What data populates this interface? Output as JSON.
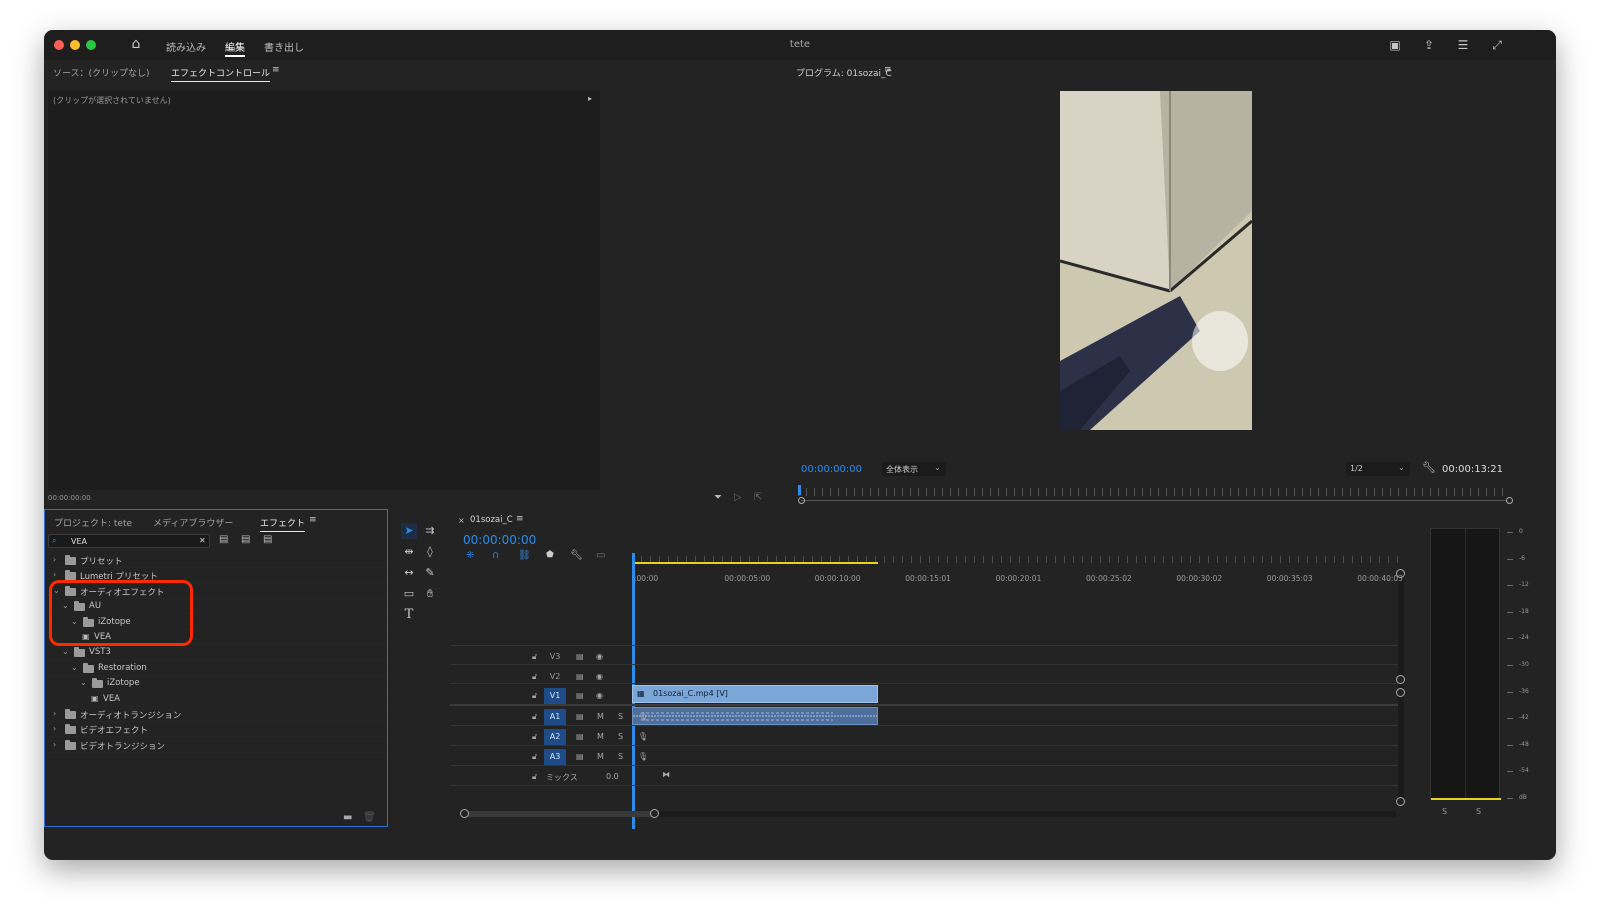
{
  "window": {
    "title": "tete"
  },
  "menu": {
    "items": [
      "読み込み",
      "編集",
      "書き出し"
    ],
    "active_index": 1
  },
  "source_panel": {
    "tabs": [
      "ソース：(クリップなし)",
      "エフェクトコントロール"
    ],
    "active_tab": 1,
    "no_clip_message": "(クリップが選択されていません)",
    "timecode": "00:00:00:00"
  },
  "program_monitor": {
    "title": "プログラム: 01sozai_C",
    "timecode_current": "00:00:00:00",
    "zoom": "全体表示",
    "resolution": "1/2",
    "timecode_duration": "00:00:13:21"
  },
  "project_panel": {
    "tabs": [
      "プロジェクト: tete",
      "メディアブラウザー",
      "エフェクト"
    ],
    "active_tab": 2,
    "search_value": "VEA",
    "tree": [
      {
        "label": "プリセット",
        "level": 0,
        "expanded": false
      },
      {
        "label": "Lumetri プリセット",
        "level": 0,
        "expanded": false
      },
      {
        "label": "オーディオエフェクト",
        "level": 0,
        "expanded": true
      },
      {
        "label": "AU",
        "level": 1,
        "expanded": true
      },
      {
        "label": "iZotope",
        "level": 2,
        "expanded": true
      },
      {
        "label": "VEA",
        "level": 3,
        "effect": true
      },
      {
        "label": "VST3",
        "level": 1,
        "expanded": true
      },
      {
        "label": "Restoration",
        "level": 2,
        "expanded": true
      },
      {
        "label": "iZotope",
        "level": 3,
        "expanded": true
      },
      {
        "label": "VEA",
        "level": 4,
        "effect": true
      },
      {
        "label": "オーディオトランジション",
        "level": 0,
        "expanded": false
      },
      {
        "label": "ビデオエフェクト",
        "level": 0,
        "expanded": false
      },
      {
        "label": "ビデオトランジション",
        "level": 0,
        "expanded": false
      }
    ]
  },
  "timeline": {
    "sequence_tab": "01sozai_C",
    "timecode": "00:00:00:00",
    "ruler_labels": [
      ":00:00",
      "00:00:05:00",
      "00:00:10:00",
      "00:00:15:01",
      "00:00:20:01",
      "00:00:25:02",
      "00:00:30:02",
      "00:00:35:03",
      "00:00:40:03"
    ],
    "video_tracks": [
      "V3",
      "V2",
      "V1"
    ],
    "audio_tracks": [
      "A1",
      "A2",
      "A3"
    ],
    "mix_label": "ミックス",
    "mix_value": "0.0",
    "mute_label": "M",
    "solo_label": "S",
    "clip_label": "01sozai_C.mp4 [V]"
  },
  "audio_meter": {
    "scale": [
      "0",
      "-6",
      "-12",
      "-18",
      "-24",
      "-30",
      "-36",
      "-42",
      "-48",
      "-54",
      "dB"
    ],
    "solo_labels": [
      "S",
      "S"
    ]
  },
  "colors": {
    "accent": "#2d8ceb",
    "clip_video": "#7aa6d8",
    "clip_audio": "#4e6f9c",
    "highlight": "#ff2a00"
  }
}
